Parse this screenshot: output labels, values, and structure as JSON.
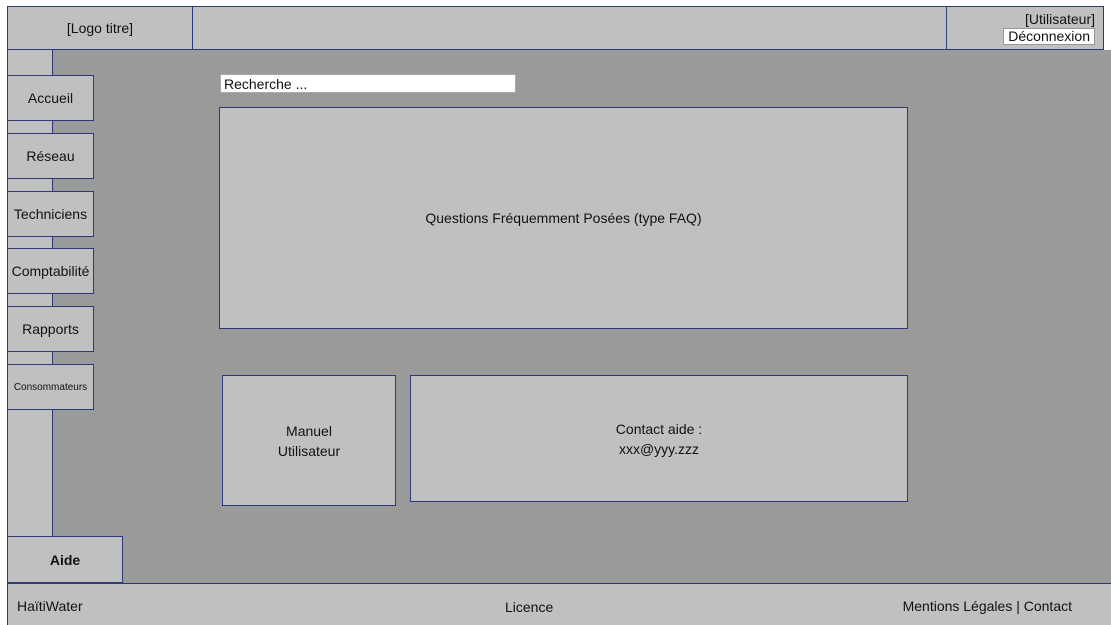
{
  "header": {
    "logo_title": "[Logo titre]",
    "user_label": "[Utilisateur]",
    "logout_label": "Déconnexion"
  },
  "sidebar": {
    "items": [
      {
        "label": "Accueil"
      },
      {
        "label": "Réseau"
      },
      {
        "label": "Techniciens"
      },
      {
        "label": "Comptabilité"
      },
      {
        "label": "Rapports"
      },
      {
        "label": "Consommateurs"
      }
    ],
    "help_label": "Aide"
  },
  "main": {
    "search_placeholder": "Recherche ...",
    "faq_label": "Questions Fréquemment Posées (type FAQ)",
    "manual_line1": "Manuel",
    "manual_line2": "Utilisateur",
    "contact_line1": "Contact aide :",
    "contact_line2": "xxx@yyy.zzz"
  },
  "footer": {
    "brand": "HaïtiWater",
    "license": "Licence",
    "legal": "Mentions Légales",
    "separator": "|",
    "contact": "Contact"
  },
  "colors": {
    "panel": "#c0c0c0",
    "background": "#9a9a9a",
    "border": "#2e3a78"
  }
}
